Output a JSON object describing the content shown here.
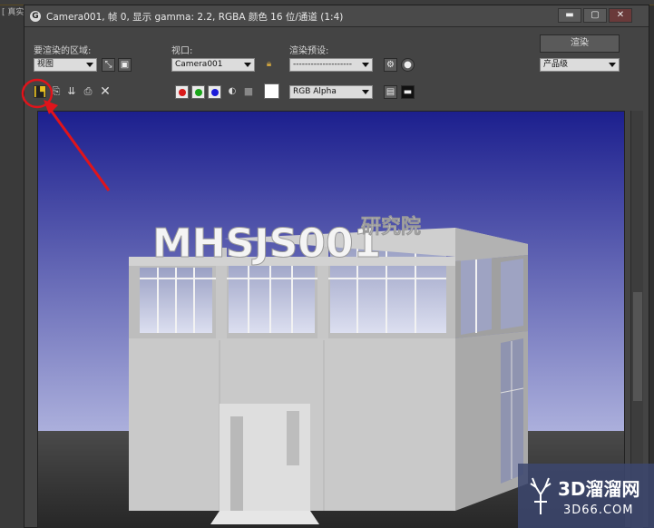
{
  "background": {
    "label": "[ 真实 ]"
  },
  "window": {
    "title": "Camera001, 帧 0, 显示 gamma: 2.2, RGBA 颜色 16 位/通道 (1:4)",
    "controls": {
      "minimize": "▬",
      "maximize": "▢",
      "close": "✕"
    }
  },
  "row1": {
    "area_label": "要渲染的区域:",
    "viewport_label": "视口:",
    "preset_label": "渲染预设:",
    "render_button": "渲染"
  },
  "row2": {
    "area_value": "视图",
    "viewport_value": "Camera001",
    "preset_value": "--------------------",
    "quality_value": "产品级"
  },
  "toolbar": {
    "channel_value": "RGB Alpha",
    "colors": {
      "red": "#d81a1a",
      "green": "#1aa51a",
      "blue": "#1a1ad8"
    }
  },
  "render": {
    "sign_main": "MHSJS001",
    "sign_sub": "研究院",
    "sky_top": "#1c1f8e",
    "sky_bottom": "#d8dcf4"
  },
  "annotation": {
    "color": "#e0141b"
  },
  "watermark": {
    "text1": "3D溜溜网",
    "text2": "3D66.COM"
  }
}
